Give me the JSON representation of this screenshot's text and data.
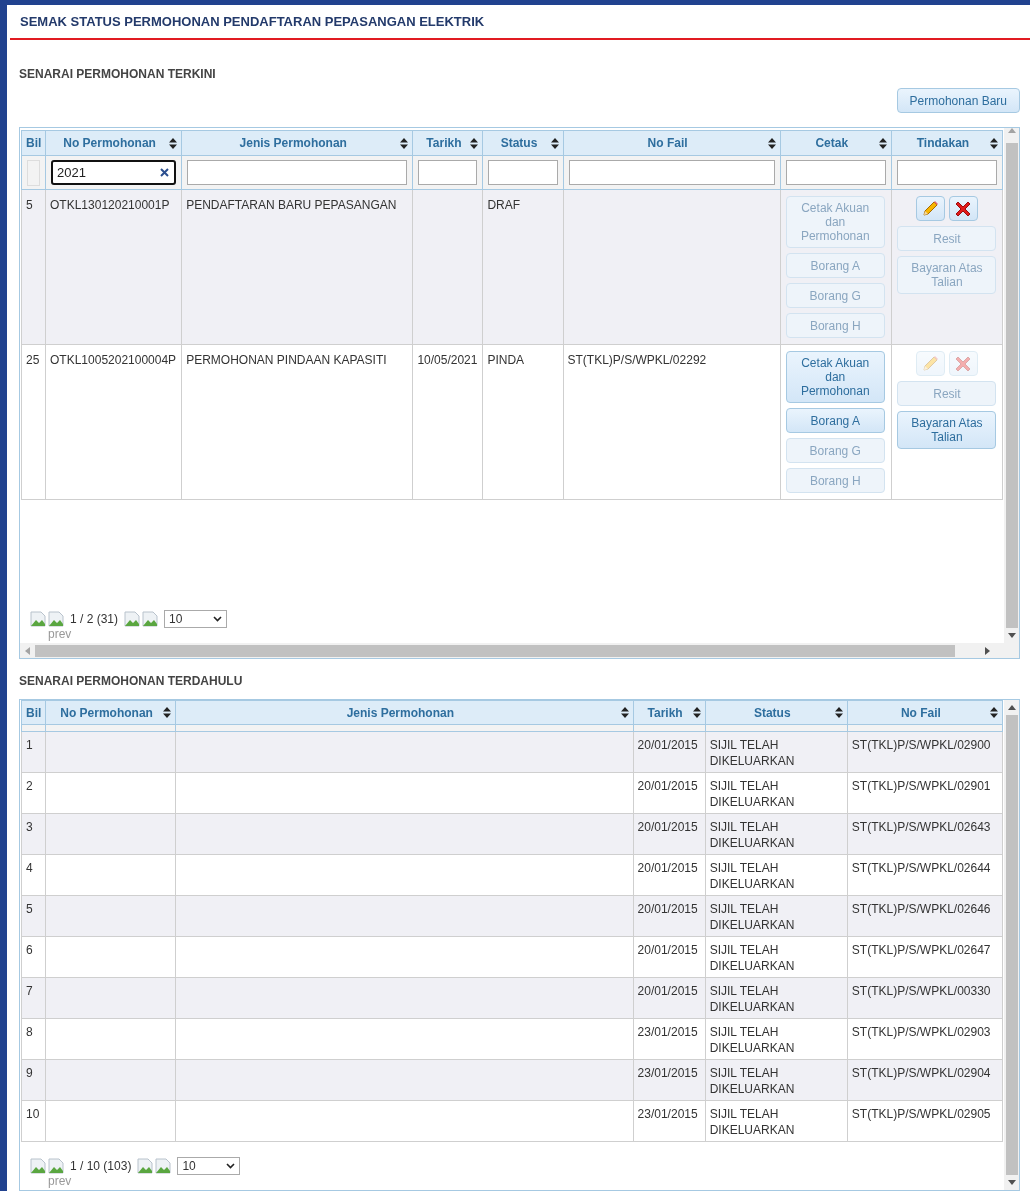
{
  "page_title": "SEMAK STATUS PERMOHONAN PENDAFTARAN PEPASANGAN ELEKTRIK",
  "current": {
    "heading": "SENARAI PERMOHONAN TERKINI",
    "new_button": "Permohonan Baru",
    "columns": [
      {
        "label": "Bil",
        "sortable": false
      },
      {
        "label": "No Permohonan",
        "sortable": true
      },
      {
        "label": "Jenis Permohonan",
        "sortable": true
      },
      {
        "label": "Tarikh",
        "sortable": true
      },
      {
        "label": "Status",
        "sortable": true
      },
      {
        "label": "No Fail",
        "sortable": true
      },
      {
        "label": "Cetak",
        "sortable": true
      },
      {
        "label": "Tindakan",
        "sortable": true
      }
    ],
    "filters": [
      {
        "kind": "blank"
      },
      {
        "kind": "input",
        "value": "2021",
        "focused": true
      },
      {
        "kind": "input",
        "focused": false
      },
      {
        "kind": "input",
        "focused": false
      },
      {
        "kind": "input",
        "focused": false
      },
      {
        "kind": "input",
        "focused": false
      },
      {
        "kind": "input",
        "focused": false
      },
      {
        "kind": "input",
        "focused": false
      }
    ],
    "rows": [
      {
        "bil": "5",
        "no": "OTKL130120210001P",
        "jenis": "PENDAFTARAN BARU PEPASANGAN",
        "status": "DRAF",
        "print_buttons": [
          {
            "label": "Cetak Akuan dan Permohonan",
            "disabled": true
          },
          {
            "label": "Borang A",
            "disabled": true
          },
          {
            "label": "Borang G",
            "disabled": true
          },
          {
            "label": "Borang H",
            "disabled": true
          }
        ],
        "edit_disabled": false,
        "delete_disabled": false,
        "action_buttons": [
          {
            "label": "Resit",
            "disabled": true
          },
          {
            "label": "Bayaran Atas Talian",
            "disabled": true
          }
        ]
      },
      {
        "bil": "25",
        "no": "OTKL1005202100004P",
        "jenis": "PERMOHONAN PINDAAN KAPASITI",
        "tarikh": "10/05/2021",
        "status": "PINDA",
        "no_fail": "ST(TKL)P/S/WPKL/02292",
        "print_buttons": [
          {
            "label": "Cetak Akuan dan Permohonan",
            "disabled": false
          },
          {
            "label": "Borang A",
            "disabled": false
          },
          {
            "label": "Borang G",
            "disabled": true
          },
          {
            "label": "Borang H",
            "disabled": true
          }
        ],
        "edit_disabled": true,
        "delete_disabled": true,
        "action_buttons": [
          {
            "label": "Resit",
            "disabled": true
          },
          {
            "label": "Bayaran Atas Talian",
            "disabled": false
          }
        ]
      }
    ],
    "pager": {
      "info": "1 / 2 (31)",
      "prev_alt": "prev",
      "page_size": "10"
    }
  },
  "previous": {
    "heading": "SENARAI PERMOHONAN TERDAHULU",
    "columns": [
      {
        "label": "Bil",
        "sortable": false
      },
      {
        "label": "No Permohonan",
        "sortable": true
      },
      {
        "label": "Jenis Permohonan",
        "sortable": true
      },
      {
        "label": "Tarikh",
        "sortable": true
      },
      {
        "label": "Status",
        "sortable": true
      },
      {
        "label": "No Fail",
        "sortable": true
      }
    ],
    "rows": [
      {
        "bil": "1",
        "tarikh": "20/01/2015",
        "status": "SIJIL TELAH DIKELUARKAN",
        "no_fail": "ST(TKL)P/S/WPKL/02900"
      },
      {
        "bil": "2",
        "tarikh": "20/01/2015",
        "status": "SIJIL TELAH DIKELUARKAN",
        "no_fail": "ST(TKL)P/S/WPKL/02901"
      },
      {
        "bil": "3",
        "tarikh": "20/01/2015",
        "status": "SIJIL TELAH DIKELUARKAN",
        "no_fail": "ST(TKL)P/S/WPKL/02643"
      },
      {
        "bil": "4",
        "tarikh": "20/01/2015",
        "status": "SIJIL TELAH DIKELUARKAN",
        "no_fail": "ST(TKL)P/S/WPKL/02644"
      },
      {
        "bil": "5",
        "tarikh": "20/01/2015",
        "status": "SIJIL TELAH DIKELUARKAN",
        "no_fail": "ST(TKL)P/S/WPKL/02646"
      },
      {
        "bil": "6",
        "tarikh": "20/01/2015",
        "status": "SIJIL TELAH DIKELUARKAN",
        "no_fail": "ST(TKL)P/S/WPKL/02647"
      },
      {
        "bil": "7",
        "tarikh": "20/01/2015",
        "status": "SIJIL TELAH DIKELUARKAN",
        "no_fail": "ST(TKL)P/S/WPKL/00330"
      },
      {
        "bil": "8",
        "tarikh": "23/01/2015",
        "status": "SIJIL TELAH DIKELUARKAN",
        "no_fail": "ST(TKL)P/S/WPKL/02903"
      },
      {
        "bil": "9",
        "tarikh": "23/01/2015",
        "status": "SIJIL TELAH DIKELUARKAN",
        "no_fail": "ST(TKL)P/S/WPKL/02904"
      },
      {
        "bil": "10",
        "tarikh": "23/01/2015",
        "status": "SIJIL TELAH DIKELUARKAN",
        "no_fail": "ST(TKL)P/S/WPKL/02905"
      }
    ],
    "pager": {
      "info": "1 / 10 (103)",
      "prev_alt": "prev",
      "page_size": "10"
    }
  }
}
